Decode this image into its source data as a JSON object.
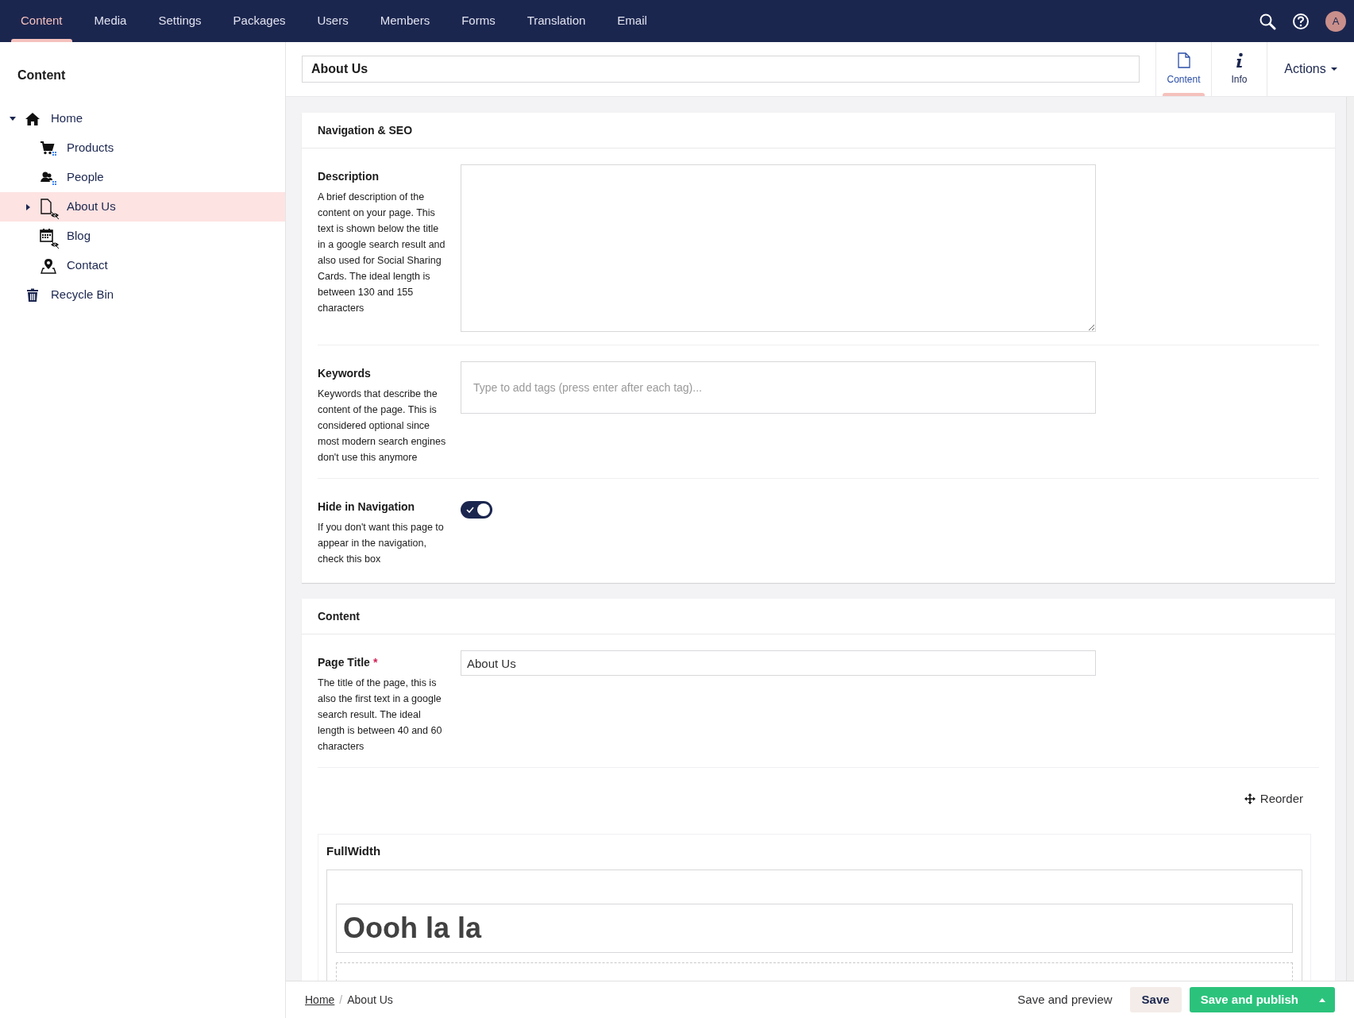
{
  "top_nav": {
    "sections": [
      {
        "label": "Content",
        "selected": true
      },
      {
        "label": "Media",
        "selected": false
      },
      {
        "label": "Settings",
        "selected": false
      },
      {
        "label": "Packages",
        "selected": false
      },
      {
        "label": "Users",
        "selected": false
      },
      {
        "label": "Members",
        "selected": false
      },
      {
        "label": "Forms",
        "selected": false
      },
      {
        "label": "Translation",
        "selected": false
      },
      {
        "label": "Email",
        "selected": false
      }
    ],
    "avatar_initial": "A"
  },
  "sidebar": {
    "title": "Content",
    "tree": [
      {
        "label": "Home",
        "kind": "home",
        "expanded": true,
        "selected": false,
        "hidden_in_navigation": false,
        "children": [
          {
            "label": "Products",
            "kind": "product-list",
            "selected": false,
            "hidden_in_navigation": false
          },
          {
            "label": "People",
            "kind": "people-list",
            "selected": false,
            "hidden_in_navigation": false
          },
          {
            "label": "About Us",
            "kind": "page",
            "expanded": false,
            "selected": true,
            "hidden_in_navigation": true
          },
          {
            "label": "Blog",
            "kind": "blog",
            "selected": false,
            "hidden_in_navigation": true
          },
          {
            "label": "Contact",
            "kind": "contact",
            "selected": false,
            "hidden_in_navigation": false
          }
        ]
      },
      {
        "label": "Recycle Bin",
        "kind": "recycle-bin",
        "selected": false,
        "hidden_in_navigation": false
      }
    ]
  },
  "editor": {
    "name": "About Us",
    "apps": [
      {
        "label": "Content",
        "kind": "document",
        "selected": true
      },
      {
        "label": "Info",
        "kind": "info",
        "selected": false
      }
    ],
    "actions": "Actions",
    "groups": [
      {
        "title": "Navigation & SEO",
        "properties": [
          {
            "kind": "textarea",
            "label": "Description",
            "description": "A brief description of the content on your page. This text is shown below the title in a google search result and also used for Social Sharing Cards. The ideal length is between 130 and 155 characters"
          },
          {
            "kind": "tags",
            "label": "Keywords",
            "description": "Keywords that describe the content of the page. This is considered optional since most modern search engines don't use this anymore",
            "placeholder": "Type to add tags (press enter after each tag)..."
          },
          {
            "kind": "toggle",
            "label": "Hide in Navigation",
            "description": "If you don't want this page to appear in the navigation, check this box",
            "on": true
          }
        ]
      },
      {
        "title": "Content",
        "properties": [
          {
            "kind": "text",
            "label": "Page Title",
            "required_mark": "*",
            "description": "The title of the page, this is also the first text in a google search result. The ideal length is between 40 and 60 characters",
            "value": "About Us"
          }
        ],
        "reorder": "Reorder",
        "block": {
          "title": "FullWidth",
          "heading": "Oooh la la"
        }
      }
    ]
  },
  "footer": {
    "breadcrumb": [
      {
        "label": "Home",
        "link": true
      },
      {
        "label": "About Us",
        "link": false
      }
    ],
    "separator": "/",
    "buttons": [
      {
        "label": "Save and preview",
        "kind": "link"
      },
      {
        "label": "Save",
        "kind": "secondary"
      },
      {
        "label": "Save and publish",
        "kind": "primary"
      }
    ]
  }
}
